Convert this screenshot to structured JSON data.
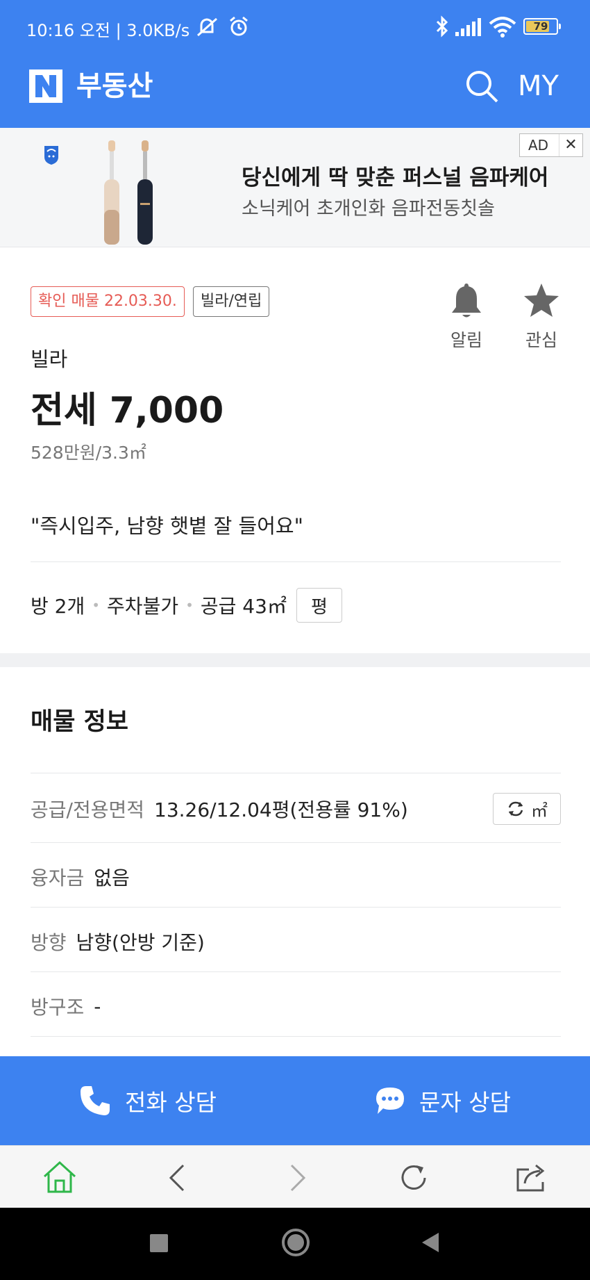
{
  "status_bar": {
    "time": "10:16 오전 | 3.0KB/s",
    "battery_level": "79"
  },
  "header": {
    "logo": "N",
    "title": "부동산",
    "my_label": "MY"
  },
  "ad": {
    "brand": "PHILIPS",
    "headline": "당신에게 딱 맞춘 퍼스널 음파케어",
    "sub": "소닉케어 초개인화 음파전동칫솔",
    "badge": "AD",
    "close": "✕"
  },
  "listing": {
    "verified_tag": "확인 매물 22.03.30.",
    "type_tag": "빌라/연립",
    "alarm_label": "알림",
    "favorite_label": "관심",
    "kind": "빌라",
    "price": "전세 7,000",
    "unit_price": "528만원/3.3㎡",
    "tagline": "\"즉시입주, 남향 햇볕 잘 들어요\"",
    "features": [
      "방 2개",
      "주차불가",
      "공급 43㎡"
    ],
    "pyeong_button": "평"
  },
  "info": {
    "title": "매물 정보",
    "rows": [
      {
        "label": "공급/전용면적",
        "value": "13.26/12.04평(전용률 91%)"
      },
      {
        "label": "융자금",
        "value": "없음"
      },
      {
        "label": "방향",
        "value": "남향(안방 기준)"
      },
      {
        "label": "방구조",
        "value": "-"
      }
    ],
    "unit_toggle": "㎡"
  },
  "cta": {
    "call": "전화 상담",
    "message": "문자 상담"
  },
  "colors": {
    "primary": "#3d82f0",
    "verified": "#e65b55",
    "home_active": "#2fb74a"
  }
}
